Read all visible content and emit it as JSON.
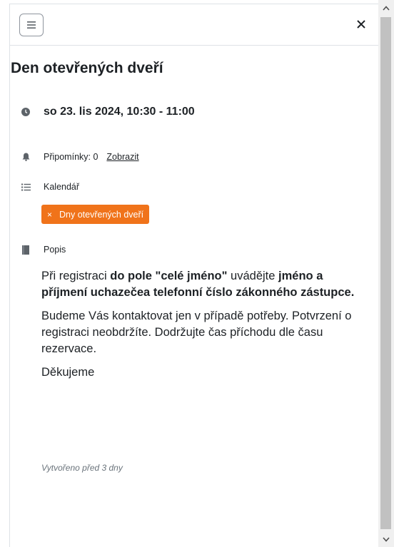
{
  "header": {
    "menu_icon": "hamburger-menu-icon",
    "close_icon": "close-icon"
  },
  "event": {
    "title": "Den otevřených dveří",
    "datetime": "so 23. lis 2024, 10:30 - 11:00",
    "reminders_label": "Připomínky: 0",
    "reminders_link": "Zobrazit",
    "calendar_label": "Kalendář",
    "calendar_tag": "Dny otevřených dveří",
    "calendar_tag_remove": "×",
    "description_label": "Popis",
    "description": {
      "p1_a": "Při registraci ",
      "p1_b": "do pole \"celé jméno\"",
      "p1_c": " uvádějte ",
      "p1_d": "jméno a příjmení uchazečea telefonní číslo zákonného zástupce.",
      "p2": "Budeme Vás kontaktovat jen v případě potřeby. Potvrzení o registraci neobdržíte. Dodržujte čas příchodu dle času rezervace.",
      "p3": "Děkujeme"
    },
    "created": "Vytvořeno před 3 dny"
  },
  "colors": {
    "accent": "#f0731a",
    "text": "#1d2125",
    "muted": "#6a737b"
  }
}
